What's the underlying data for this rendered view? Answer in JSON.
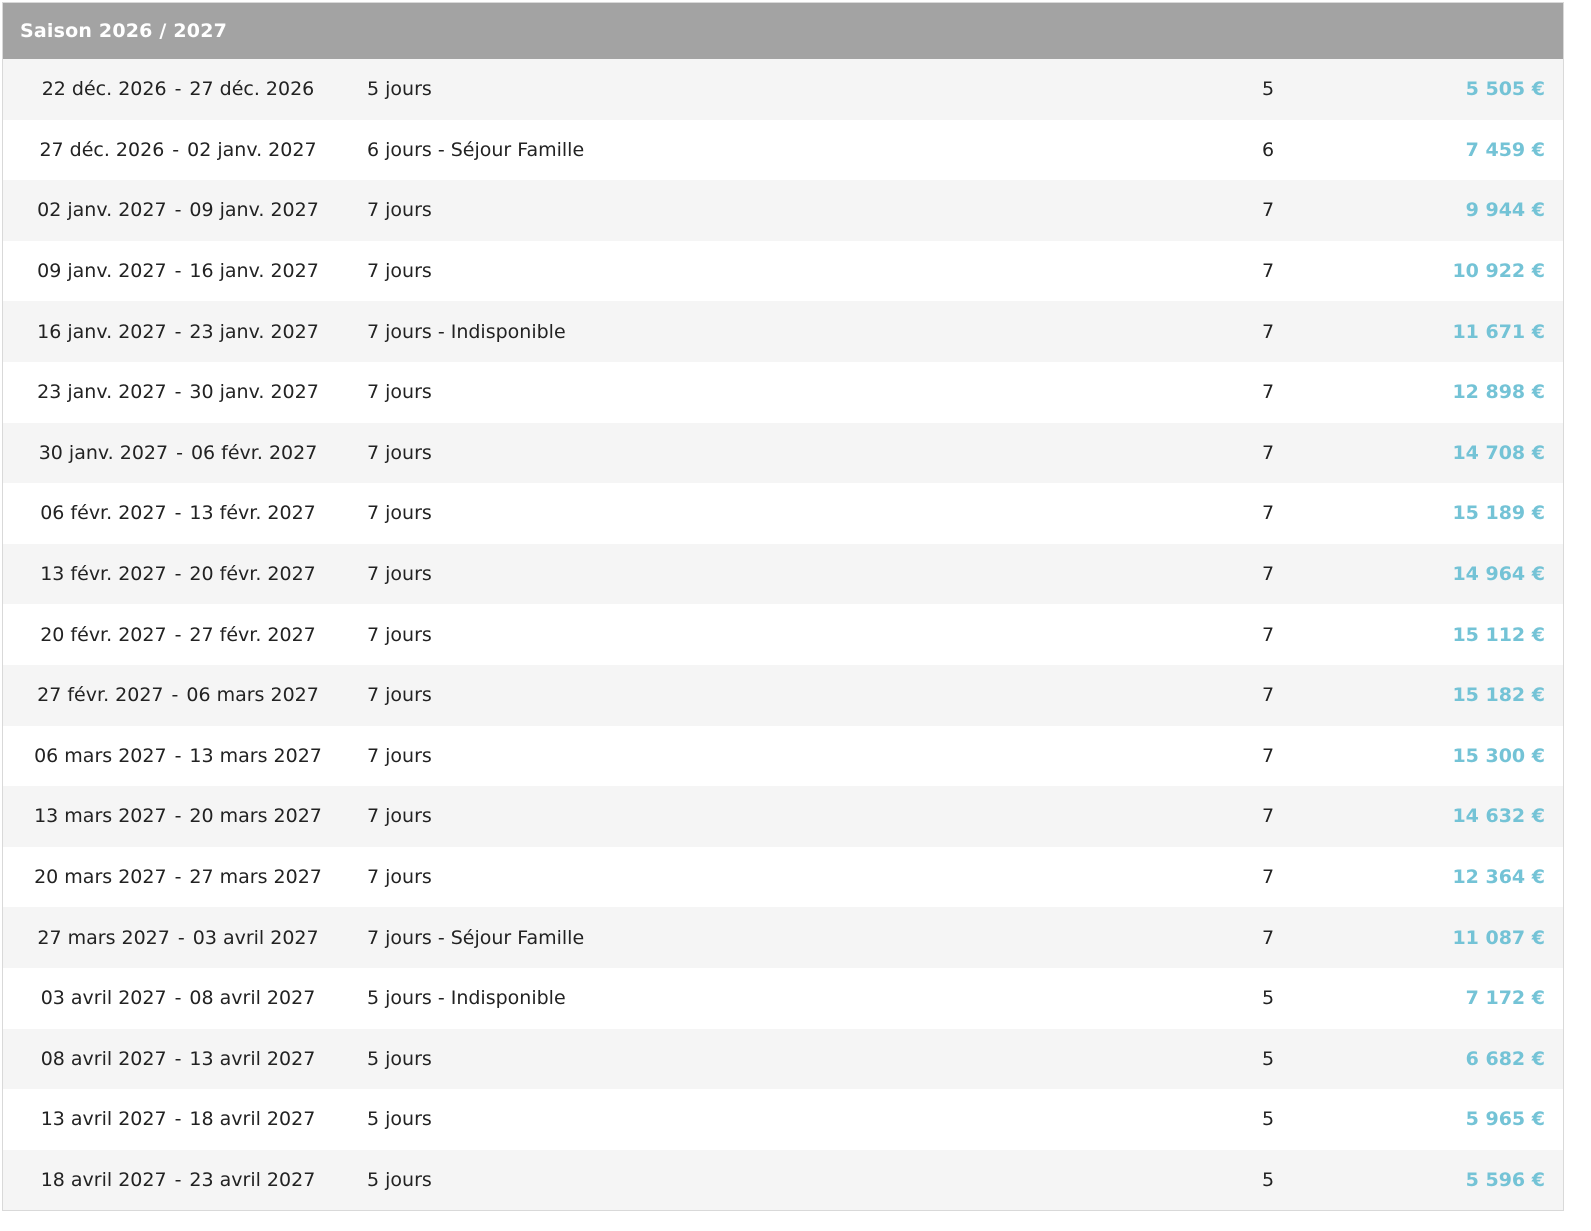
{
  "season": {
    "title": "Saison 2026 / 2027"
  },
  "colors": {
    "header_bg": "#a3a3a3",
    "row_odd": "#f5f5f5",
    "row_even": "#ffffff",
    "price": "#74c3d6"
  },
  "rows": [
    {
      "start": "22 déc. 2026",
      "end": "27 déc. 2026",
      "label": "5 jours",
      "nights": "5",
      "price": "5 505 €"
    },
    {
      "start": "27 déc. 2026",
      "end": "02 janv. 2027",
      "label": "6 jours - Séjour Famille",
      "nights": "6",
      "price": "7 459 €"
    },
    {
      "start": "02 janv. 2027",
      "end": "09 janv. 2027",
      "label": "7 jours",
      "nights": "7",
      "price": "9 944 €"
    },
    {
      "start": "09 janv. 2027",
      "end": "16 janv. 2027",
      "label": "7 jours",
      "nights": "7",
      "price": "10 922 €"
    },
    {
      "start": "16 janv. 2027",
      "end": "23 janv. 2027",
      "label": "7 jours - Indisponible",
      "nights": "7",
      "price": "11 671 €"
    },
    {
      "start": "23 janv. 2027",
      "end": "30 janv. 2027",
      "label": "7 jours",
      "nights": "7",
      "price": "12 898 €"
    },
    {
      "start": "30 janv. 2027",
      "end": "06 févr. 2027",
      "label": "7 jours",
      "nights": "7",
      "price": "14 708 €"
    },
    {
      "start": "06 févr. 2027",
      "end": "13 févr. 2027",
      "label": "7 jours",
      "nights": "7",
      "price": "15 189 €"
    },
    {
      "start": "13 févr. 2027",
      "end": "20 févr. 2027",
      "label": "7 jours",
      "nights": "7",
      "price": "14 964 €"
    },
    {
      "start": "20 févr. 2027",
      "end": "27 févr. 2027",
      "label": "7 jours",
      "nights": "7",
      "price": "15 112 €"
    },
    {
      "start": "27 févr. 2027",
      "end": "06 mars 2027",
      "label": "7 jours",
      "nights": "7",
      "price": "15 182 €"
    },
    {
      "start": "06 mars 2027",
      "end": "13 mars 2027",
      "label": "7 jours",
      "nights": "7",
      "price": "15 300 €"
    },
    {
      "start": "13 mars 2027",
      "end": "20 mars 2027",
      "label": "7 jours",
      "nights": "7",
      "price": "14 632 €"
    },
    {
      "start": "20 mars 2027",
      "end": "27 mars 2027",
      "label": "7 jours",
      "nights": "7",
      "price": "12 364 €"
    },
    {
      "start": "27 mars 2027",
      "end": "03 avril 2027",
      "label": "7 jours - Séjour Famille",
      "nights": "7",
      "price": "11 087 €"
    },
    {
      "start": "03 avril 2027",
      "end": "08 avril 2027",
      "label": "5 jours - Indisponible",
      "nights": "5",
      "price": "7 172 €"
    },
    {
      "start": "08 avril 2027",
      "end": "13 avril 2027",
      "label": "5 jours",
      "nights": "5",
      "price": "6 682 €"
    },
    {
      "start": "13 avril 2027",
      "end": "18 avril 2027",
      "label": "5 jours",
      "nights": "5",
      "price": "5 965 €"
    },
    {
      "start": "18 avril 2027",
      "end": "23 avril 2027",
      "label": "5 jours",
      "nights": "5",
      "price": "5 596 €"
    }
  ],
  "date_separator": "-"
}
